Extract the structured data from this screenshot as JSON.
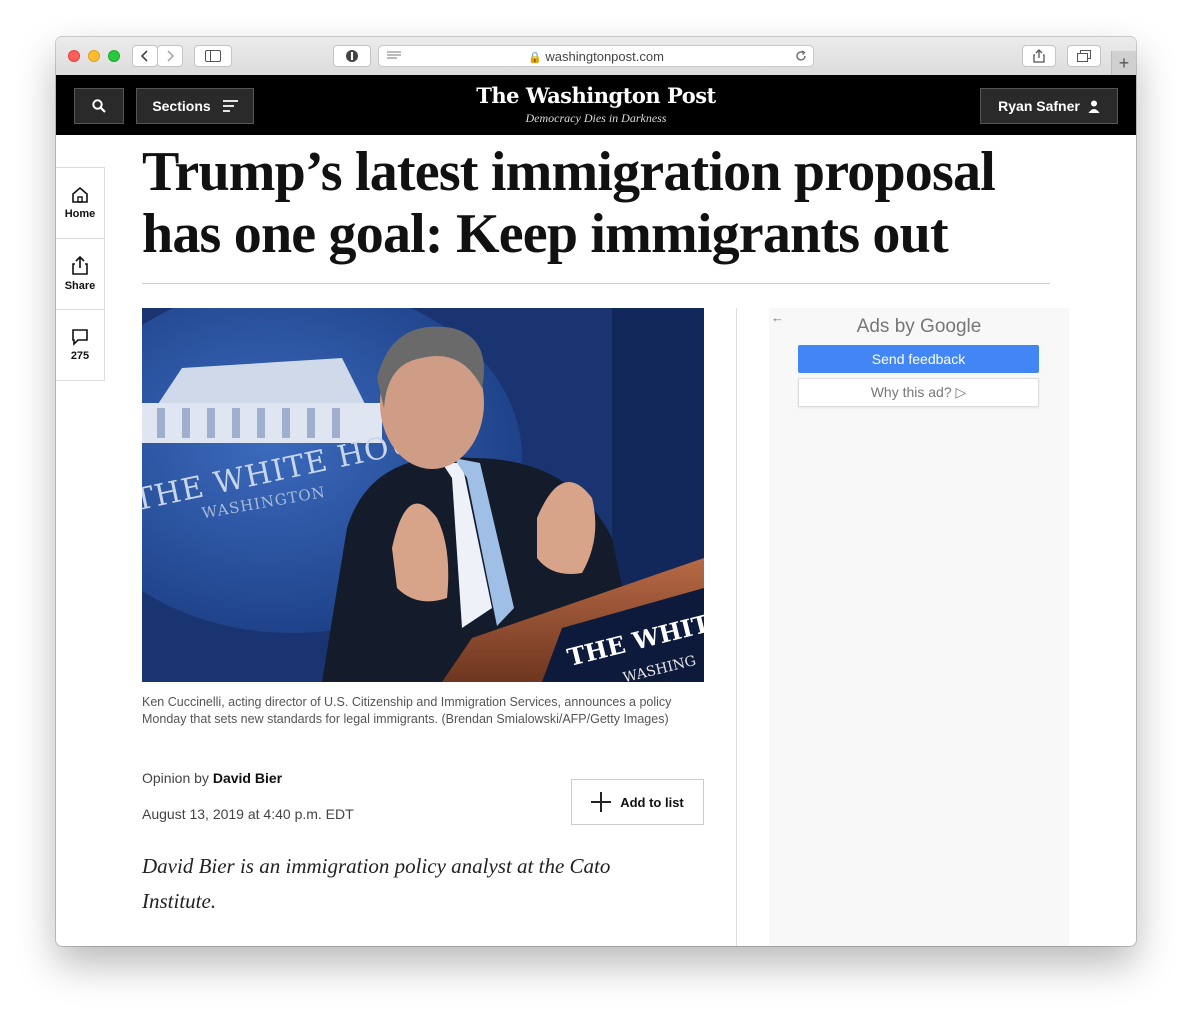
{
  "browser": {
    "url": "washingtonpost.com",
    "new_tab_label": "+"
  },
  "header": {
    "logo_text": "The Washington Post",
    "tagline": "Democracy Dies in Darkness",
    "sections_label": "Sections",
    "user_name": "Ryan Safner"
  },
  "rail": {
    "home_label": "Home",
    "share_label": "Share",
    "comments_count": "275"
  },
  "article": {
    "headline": "Trump’s latest immigration proposal has one goal: Keep immigrants out",
    "caption": "Ken Cuccinelli, acting director of U.S. Citizenship and Immigration Services, announces a policy Monday that sets new standards for legal immigrants. (Brendan Smialowski/AFP/Getty Images)",
    "byline_prefix": "Opinion by",
    "author": "David Bier",
    "date": "August 13, 2019 at 4:40 p.m. EDT",
    "add_to_list_label": "Add to list",
    "author_note": "David Bier is an immigration policy analyst at the Cato Institute.",
    "photo_texts": {
      "seal_top": "THE WHITE HOUSE",
      "seal_bottom": "WASHINGTON",
      "podium_top": "THE WHITE",
      "podium_bottom": "WASHING"
    }
  },
  "ad": {
    "back_arrow": "←",
    "ads_by_prefix": "Ads by",
    "ads_by_brand": "Google",
    "send_feedback": "Send feedback",
    "why_this_ad": "Why this ad? ▷"
  },
  "colors": {
    "header_bg": "#000000",
    "feedback_blue": "#4285f4"
  }
}
